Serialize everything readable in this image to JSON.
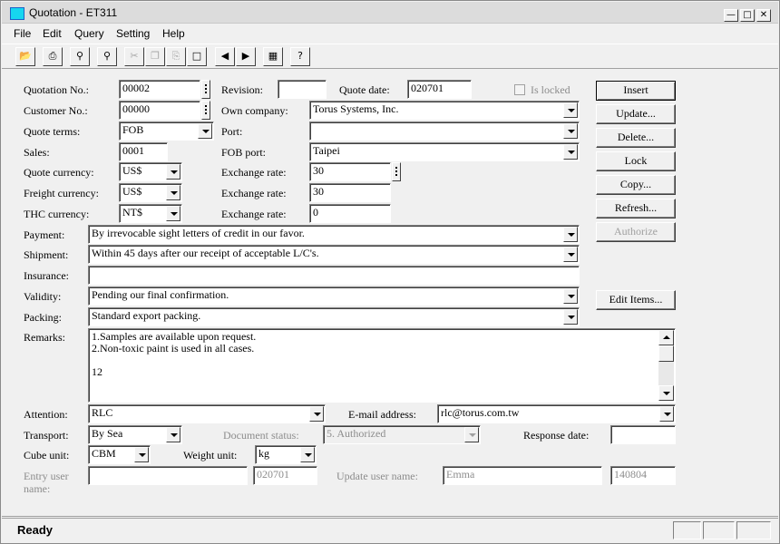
{
  "window": {
    "title": "Quotation - ET311"
  },
  "menu": [
    "File",
    "Edit",
    "Query",
    "Setting",
    "Help"
  ],
  "toolbar_icons": [
    "open-icon",
    "print-icon",
    "find-icon",
    "query-icon",
    "cut-icon",
    "copy-icon",
    "paste-icon",
    "new-icon",
    "prev-icon",
    "next-icon",
    "book-icon",
    "help-icon"
  ],
  "labels": {
    "quotation_no": "Quotation No.:",
    "customer_no": "Customer No.:",
    "quote_terms": "Quote terms:",
    "sales": "Sales:",
    "quote_currency": "Quote currency:",
    "freight_currency": "Freight currency:",
    "thc_currency": "THC currency:",
    "revision": "Revision:",
    "quote_date": "Quote date:",
    "is_locked": "Is locked",
    "own_company": "Own company:",
    "port": "Port:",
    "fob_port": "FOB port:",
    "exchange_rate": "Exchange rate:",
    "payment": "Payment:",
    "shipment": "Shipment:",
    "insurance": "Insurance:",
    "validity": "Validity:",
    "packing": "Packing:",
    "remarks": "Remarks:",
    "attention": "Attention:",
    "email": "E-mail address:",
    "transport": "Transport:",
    "document_status": "Document status:",
    "response_date": "Response date:",
    "cube_unit": "Cube unit:",
    "weight_unit": "Weight unit:",
    "entry_user_line1": "Entry user",
    "entry_user_line2": "name:",
    "update_user": "Update user name:"
  },
  "values": {
    "quotation_no": "00002",
    "customer_no": "00000",
    "quote_terms": "FOB",
    "sales": "0001",
    "quote_currency": "US$",
    "freight_currency": "US$",
    "thc_currency": "NT$",
    "revision": "",
    "quote_date": "020701",
    "own_company": "Torus Systems, Inc.",
    "port": "",
    "fob_port": "Taipei",
    "exchange_rate_1": "30",
    "exchange_rate_2": "30",
    "exchange_rate_3": "0",
    "payment": "By irrevocable sight letters of credit in our favor.",
    "shipment": "Within 45 days after our receipt of acceptable L/C's.",
    "insurance": "",
    "validity": "Pending our final confirmation.",
    "packing": "Standard export packing.",
    "remarks": [
      "1.Samples are available upon request.",
      "2.Non-toxic paint is used in all cases.",
      "",
      "12"
    ],
    "attention": "RLC",
    "email": "rlc@torus.com.tw",
    "transport": "By Sea",
    "document_status": "5. Authorized",
    "response_date": "",
    "cube_unit": "CBM",
    "weight_unit": "kg",
    "entry_user": "",
    "entry_date": "020701",
    "update_user": "Emma",
    "update_date": "140804"
  },
  "buttons": {
    "insert": "Insert",
    "update": "Update...",
    "delete": "Delete...",
    "lock": "Lock",
    "copy": "Copy...",
    "refresh": "Refresh...",
    "authorize": "Authorize",
    "edit_items": "Edit Items..."
  },
  "status": {
    "text": "Ready"
  }
}
